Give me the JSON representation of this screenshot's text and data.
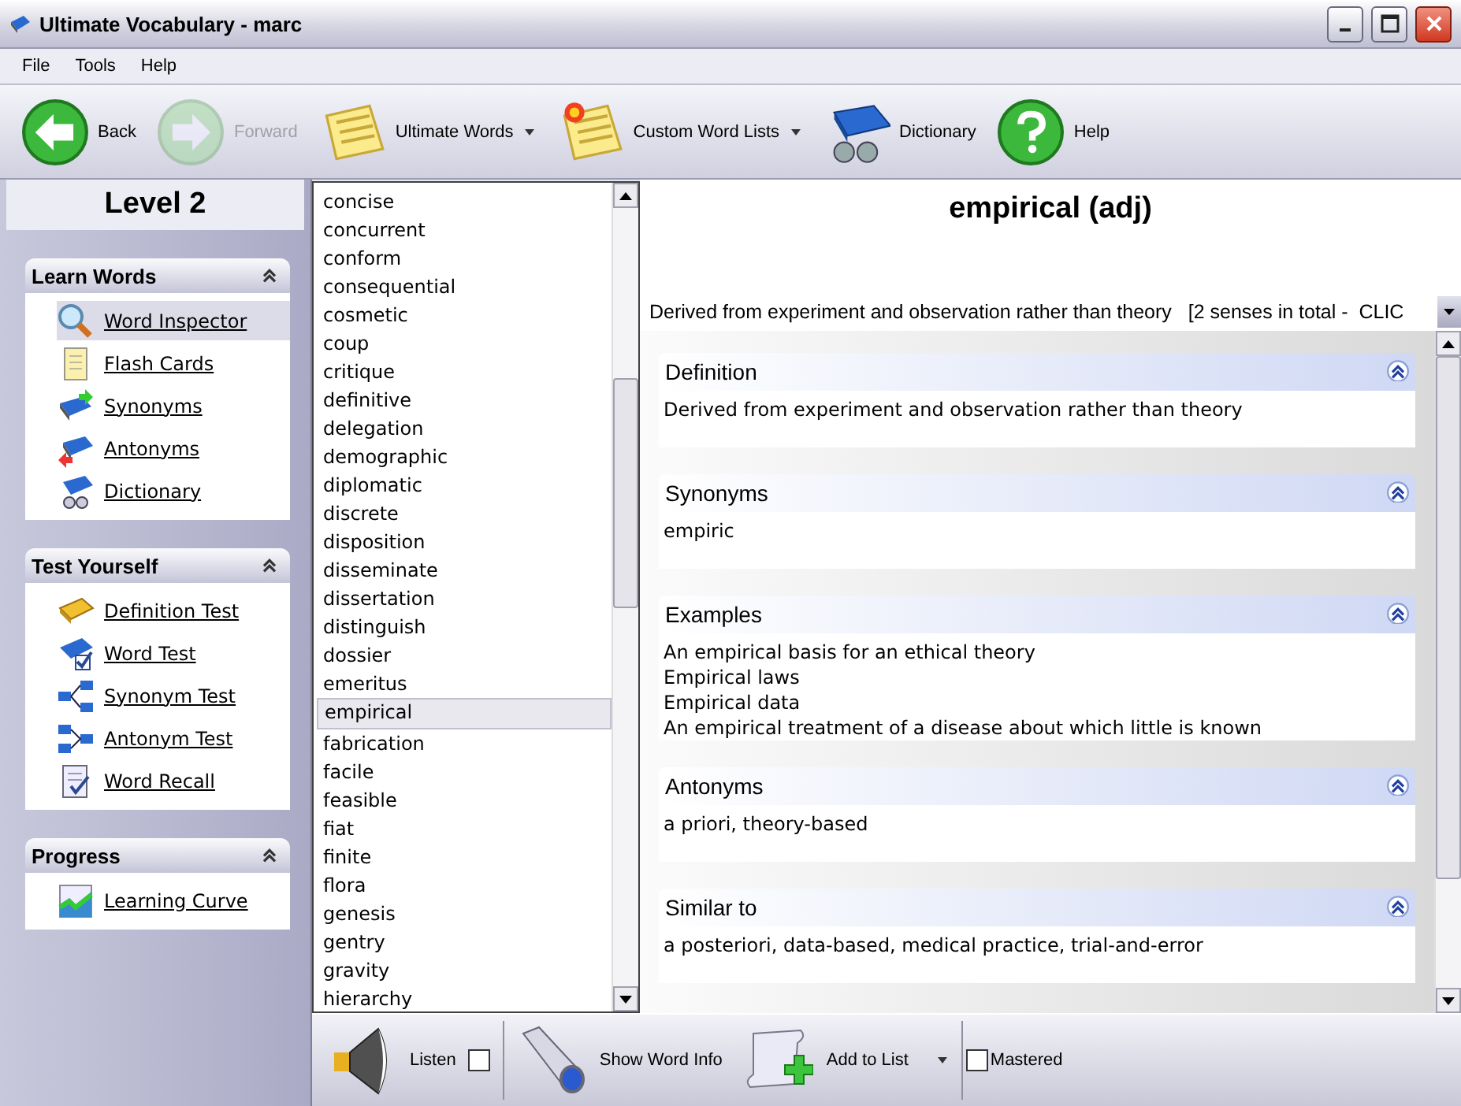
{
  "window": {
    "title": "Ultimate Vocabulary - marc"
  },
  "menu": [
    "File",
    "Tools",
    "Help"
  ],
  "toolbar": [
    {
      "label": "Back",
      "disabled": false,
      "dropdown": false
    },
    {
      "label": "Forward",
      "disabled": true,
      "dropdown": false
    },
    {
      "label": "Ultimate Words",
      "disabled": false,
      "dropdown": true
    },
    {
      "label": "Custom Word Lists",
      "disabled": false,
      "dropdown": true
    },
    {
      "label": "Dictionary",
      "disabled": false,
      "dropdown": false
    },
    {
      "label": "Help",
      "disabled": false,
      "dropdown": false
    }
  ],
  "sidebar": {
    "level": "Level 2",
    "groups": [
      {
        "title": "Learn Words",
        "expanded": true,
        "items": [
          {
            "label": "Word Inspector",
            "selected": true
          },
          {
            "label": "Flash Cards",
            "selected": false
          },
          {
            "label": "Synonyms",
            "selected": false
          },
          {
            "label": "Antonyms",
            "selected": false
          },
          {
            "label": "Dictionary",
            "selected": false
          }
        ]
      },
      {
        "title": "Test Yourself",
        "expanded": true,
        "items": [
          {
            "label": "Definition Test",
            "selected": false
          },
          {
            "label": "Word Test",
            "selected": false
          },
          {
            "label": "Synonym Test",
            "selected": false
          },
          {
            "label": "Antonym Test",
            "selected": false
          },
          {
            "label": "Word Recall",
            "selected": false
          }
        ]
      },
      {
        "title": "Progress",
        "expanded": true,
        "items": [
          {
            "label": "Learning Curve",
            "selected": false
          }
        ]
      }
    ]
  },
  "word_list": [
    {
      "word": "concise",
      "selected": false
    },
    {
      "word": "concurrent",
      "selected": false
    },
    {
      "word": "conform",
      "selected": false
    },
    {
      "word": "consequential",
      "selected": false
    },
    {
      "word": "cosmetic",
      "selected": false
    },
    {
      "word": "coup",
      "selected": false
    },
    {
      "word": "critique",
      "selected": false
    },
    {
      "word": "definitive",
      "selected": false
    },
    {
      "word": "delegation",
      "selected": false
    },
    {
      "word": "demographic",
      "selected": false
    },
    {
      "word": "diplomatic",
      "selected": false
    },
    {
      "word": "discrete",
      "selected": false
    },
    {
      "word": "disposition",
      "selected": false
    },
    {
      "word": "disseminate",
      "selected": false
    },
    {
      "word": "dissertation",
      "selected": false
    },
    {
      "word": "distinguish",
      "selected": false
    },
    {
      "word": "dossier",
      "selected": false
    },
    {
      "word": "emeritus",
      "selected": false
    },
    {
      "word": "empirical",
      "selected": true
    },
    {
      "word": "fabrication",
      "selected": false
    },
    {
      "word": "facile",
      "selected": false
    },
    {
      "word": "feasible",
      "selected": false
    },
    {
      "word": "fiat",
      "selected": false
    },
    {
      "word": "finite",
      "selected": false
    },
    {
      "word": "flora",
      "selected": false
    },
    {
      "word": "genesis",
      "selected": false
    },
    {
      "word": "gentry",
      "selected": false
    },
    {
      "word": "gravity",
      "selected": false
    },
    {
      "word": "hierarchy",
      "selected": false
    }
  ],
  "entry": {
    "heading": "empirical (adj)",
    "sense": "Derived from experiment and observation rather than theory   [2 senses in total -  CLIC",
    "sections": [
      {
        "title": "Definition",
        "expanded": true,
        "lines": [
          "Derived from experiment and observation rather than theory"
        ]
      },
      {
        "title": "Synonyms",
        "expanded": true,
        "lines": [
          "empiric"
        ]
      },
      {
        "title": "Examples",
        "expanded": true,
        "lines": [
          "An empirical basis for an ethical theory",
          "Empirical laws",
          "Empirical data",
          "An empirical treatment of a disease about which little is known"
        ]
      },
      {
        "title": "Antonyms",
        "expanded": true,
        "lines": [
          "a priori, theory-based"
        ]
      },
      {
        "title": "Similar to",
        "expanded": true,
        "lines": [
          "a posteriori, data-based, medical practice, trial-and-error"
        ]
      }
    ]
  },
  "bottom_bar": {
    "listen": {
      "label": "Listen",
      "checked": false
    },
    "show_info": {
      "label": "Show Word Info"
    },
    "add_to_list": {
      "label": "Add to List",
      "dropdown": true
    },
    "mastered": {
      "label": "Mastered",
      "checked": false
    }
  }
}
